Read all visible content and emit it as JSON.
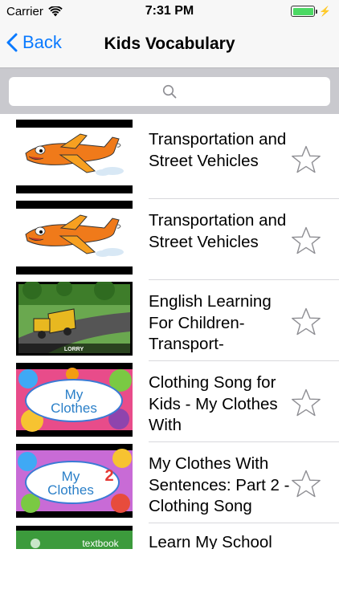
{
  "status": {
    "carrier": "Carrier",
    "time": "7:31 PM"
  },
  "nav": {
    "back_label": "Back",
    "title": "Kids Vocabulary"
  },
  "search": {
    "placeholder": ""
  },
  "colors": {
    "accent": "#0a7aff",
    "battery": "#4cd964"
  },
  "videos": [
    {
      "title": "Transportation and Street Vehicles",
      "thumbnail": "cartoon-airplane",
      "favorite": false
    },
    {
      "title": "Transportation and Street Vehicles",
      "thumbnail": "cartoon-airplane",
      "favorite": false
    },
    {
      "title": "English Learning For Children- Transport-",
      "thumbnail": "lorry-on-road",
      "thumb_caption": "LORRY",
      "favorite": false
    },
    {
      "title": "Clothing Song for Kids - My Clothes With",
      "thumbnail": "my-clothes-title",
      "thumb_line1": "My",
      "thumb_line2": "Clothes",
      "favorite": false
    },
    {
      "title": "My Clothes With Sentences: Part 2 - Clothing Song",
      "thumbnail": "my-clothes-2-title",
      "thumb_line1": "My",
      "thumb_line2": "Clothes",
      "thumb_number": "2",
      "favorite": false
    },
    {
      "title": "Learn My School",
      "thumbnail": "textbook",
      "thumb_caption": "textbook",
      "favorite": false
    }
  ]
}
